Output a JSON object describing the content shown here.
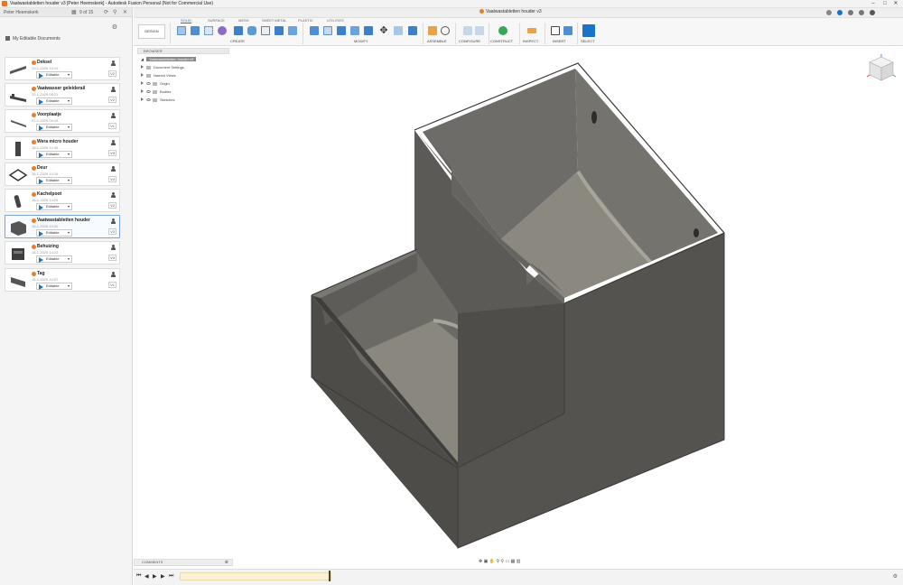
{
  "window": {
    "title": "Vaatwastabletten houder v3 [Peter Heemskerk] - Autodesk Fusion Personal (Not for Commercial Use)",
    "min_icon": "minimize-icon",
    "max_icon": "maximize-icon",
    "close_icon": "close-icon"
  },
  "data_panel": {
    "user": "Peter Heemskerk",
    "page": "9 of 15",
    "breadcrumb": "My Editable Documents",
    "items": [
      {
        "name": "Deksel",
        "date": "10-1-2025 13:19",
        "badge": "Editable",
        "version": "V2"
      },
      {
        "name": "Vaatwasser geleiderail",
        "date": "10-1-2025 08:21",
        "badge": "Editable",
        "version": "V2"
      },
      {
        "name": "Voorplaatje",
        "date": "21-1-2025 09:19",
        "badge": "Editable",
        "version": "V1"
      },
      {
        "name": "Wera micro houder",
        "date": "16-1-2025 12:46",
        "badge": "Editable",
        "version": "V3"
      },
      {
        "name": "Deur",
        "date": "16-1-2025 10:16",
        "badge": "Editable",
        "version": "V4"
      },
      {
        "name": "Kachelpoot",
        "date": "16-1-2025 14:29",
        "badge": "Editable",
        "version": "V2"
      },
      {
        "name": "Vaatwastabletten houder",
        "date": "18-1-2025 10:30",
        "badge": "Editable",
        "version": "V3"
      },
      {
        "name": "Behuizing",
        "date": "18-1-2025 14:22",
        "badge": "Editable",
        "version": "V3"
      },
      {
        "name": "Tag",
        "date": "18-1-2025 10:07",
        "badge": "Editable",
        "version": "V1"
      }
    ]
  },
  "toolbar": {
    "doc_tab": "Vaatwastabletten houder v3",
    "tabs": [
      "SOLID",
      "SURFACE",
      "MESH",
      "SHEET METAL",
      "PLASTIC",
      "UTILITIES"
    ],
    "active_tab": "SOLID",
    "workspace": "DESIGN",
    "groups": [
      "CREATE",
      "MODIFY",
      "ASSEMBLE",
      "CONFIGURE",
      "CONSTRUCT",
      "INSPECT",
      "INSERT",
      "SELECT"
    ]
  },
  "browser": {
    "header": "BROWSER",
    "root": "Vaatwastabletten houder v3",
    "items": [
      "Document Settings",
      "Named Views",
      "Origin",
      "Bodies",
      "Sketches"
    ]
  },
  "comments": {
    "label": "COMMENTS"
  },
  "colors": {
    "accent": "#1a73c8",
    "fusion_orange": "#ef7c22",
    "model_grey": "#5a5853"
  }
}
